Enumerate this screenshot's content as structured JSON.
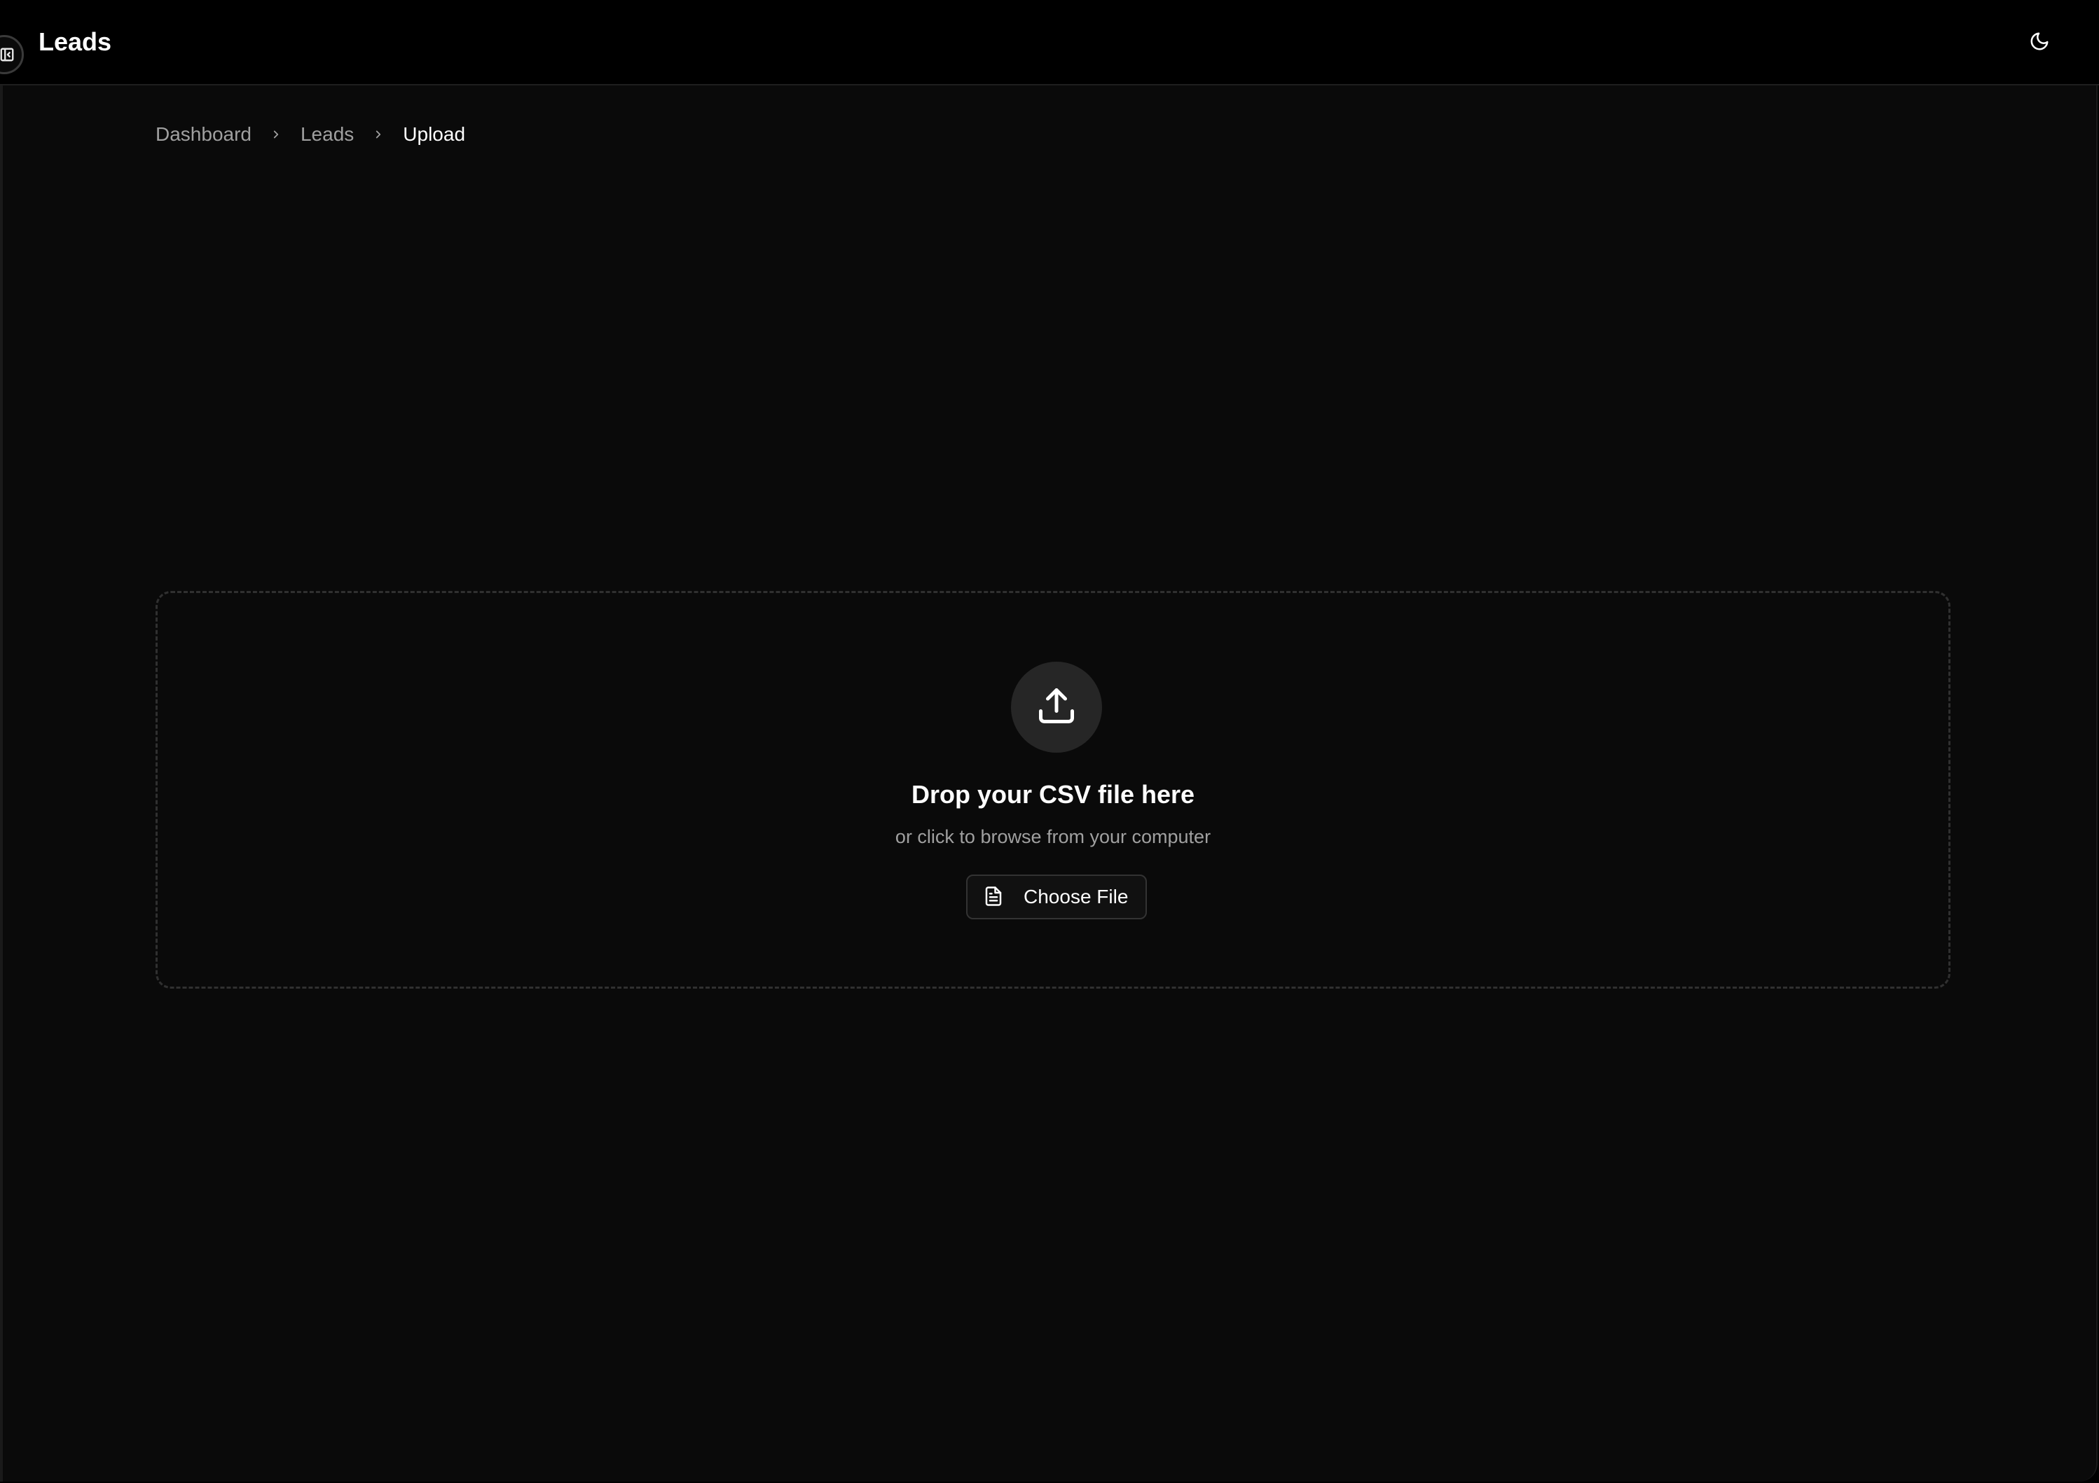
{
  "header": {
    "title": "Leads",
    "sidebar_toggle_icon": "panel-left-close-icon",
    "theme_toggle_icon": "moon-icon"
  },
  "breadcrumb": {
    "items": [
      {
        "label": "Dashboard",
        "current": false
      },
      {
        "label": "Leads",
        "current": false
      },
      {
        "label": "Upload",
        "current": true
      }
    ],
    "separator_icon": "chevron-right-icon"
  },
  "dropzone": {
    "icon": "upload-icon",
    "title": "Drop your CSV file here",
    "subtitle": "or click to browse from your computer",
    "button": {
      "label": "Choose File",
      "icon": "file-text-icon"
    }
  },
  "colors": {
    "header_background": "#000000",
    "page_background": "#0a0a0a",
    "text_primary": "#ffffff",
    "text_muted": "#a0a0a0",
    "dropzone_border": "#303030",
    "icon_circle": "#262626"
  }
}
